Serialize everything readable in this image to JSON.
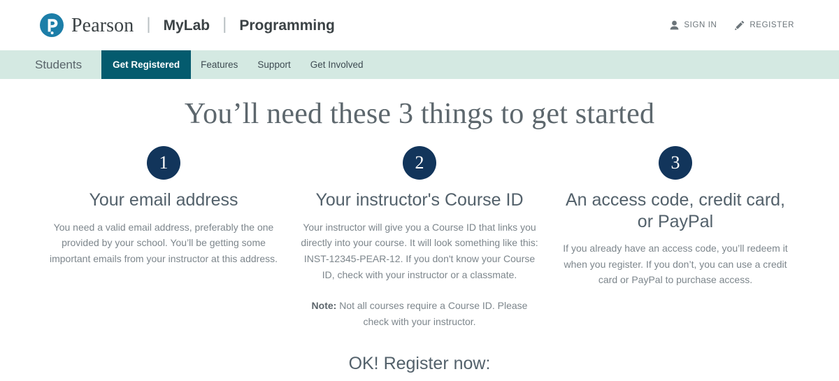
{
  "header": {
    "brand": {
      "logo_icon": "pearson-p-logo-icon",
      "wordmark": "Pearson",
      "separator": "|",
      "product": "MyLab",
      "separator2": "|",
      "discipline": "Programming"
    },
    "actions": [
      {
        "label": "SIGN IN",
        "icon": "person-icon"
      },
      {
        "label": "REGISTER",
        "icon": "pencil-icon"
      }
    ]
  },
  "nav": {
    "brand_item": "Students",
    "items": [
      {
        "label": "Get Registered",
        "active": true
      },
      {
        "label": "Features",
        "active": false
      },
      {
        "label": "Support",
        "active": false
      },
      {
        "label": "Get Involved",
        "active": false
      }
    ]
  },
  "main": {
    "title": "You’ll need these 3 things to get started",
    "columns": [
      {
        "badge": "1",
        "title": "Your email address",
        "body": "You need a valid email address, preferably the one provided by your school. You’ll be getting some important emails from your instructor at this address.",
        "note_label": "",
        "note_body": ""
      },
      {
        "badge": "2",
        "title": "Your instructor's Course ID",
        "body": "Your instructor will give you a Course ID that links you directly into your course. It will look something like this: INST-12345-PEAR-12. If you don't know your Course ID, check with your instructor or a classmate.",
        "note_label": "Note:",
        "note_body": " Not all courses require a Course ID. Please check with your instructor."
      },
      {
        "badge": "3",
        "title": "An access code, credit card, or PayPal",
        "body": "If you already have an access code, you’ll redeem it when you register. If you don’t, you can use a credit card or PayPal to purchase access.",
        "note_label": "",
        "note_body": ""
      }
    ],
    "cta": "OK! Register now:"
  },
  "colors": {
    "nav_background": "#d4e9e2",
    "nav_active": "#045b6e",
    "badge_navy": "#12355b",
    "logo_teal": "#1c7ea8",
    "heading_gray": "#53616b",
    "body_gray": "#7d868c"
  }
}
